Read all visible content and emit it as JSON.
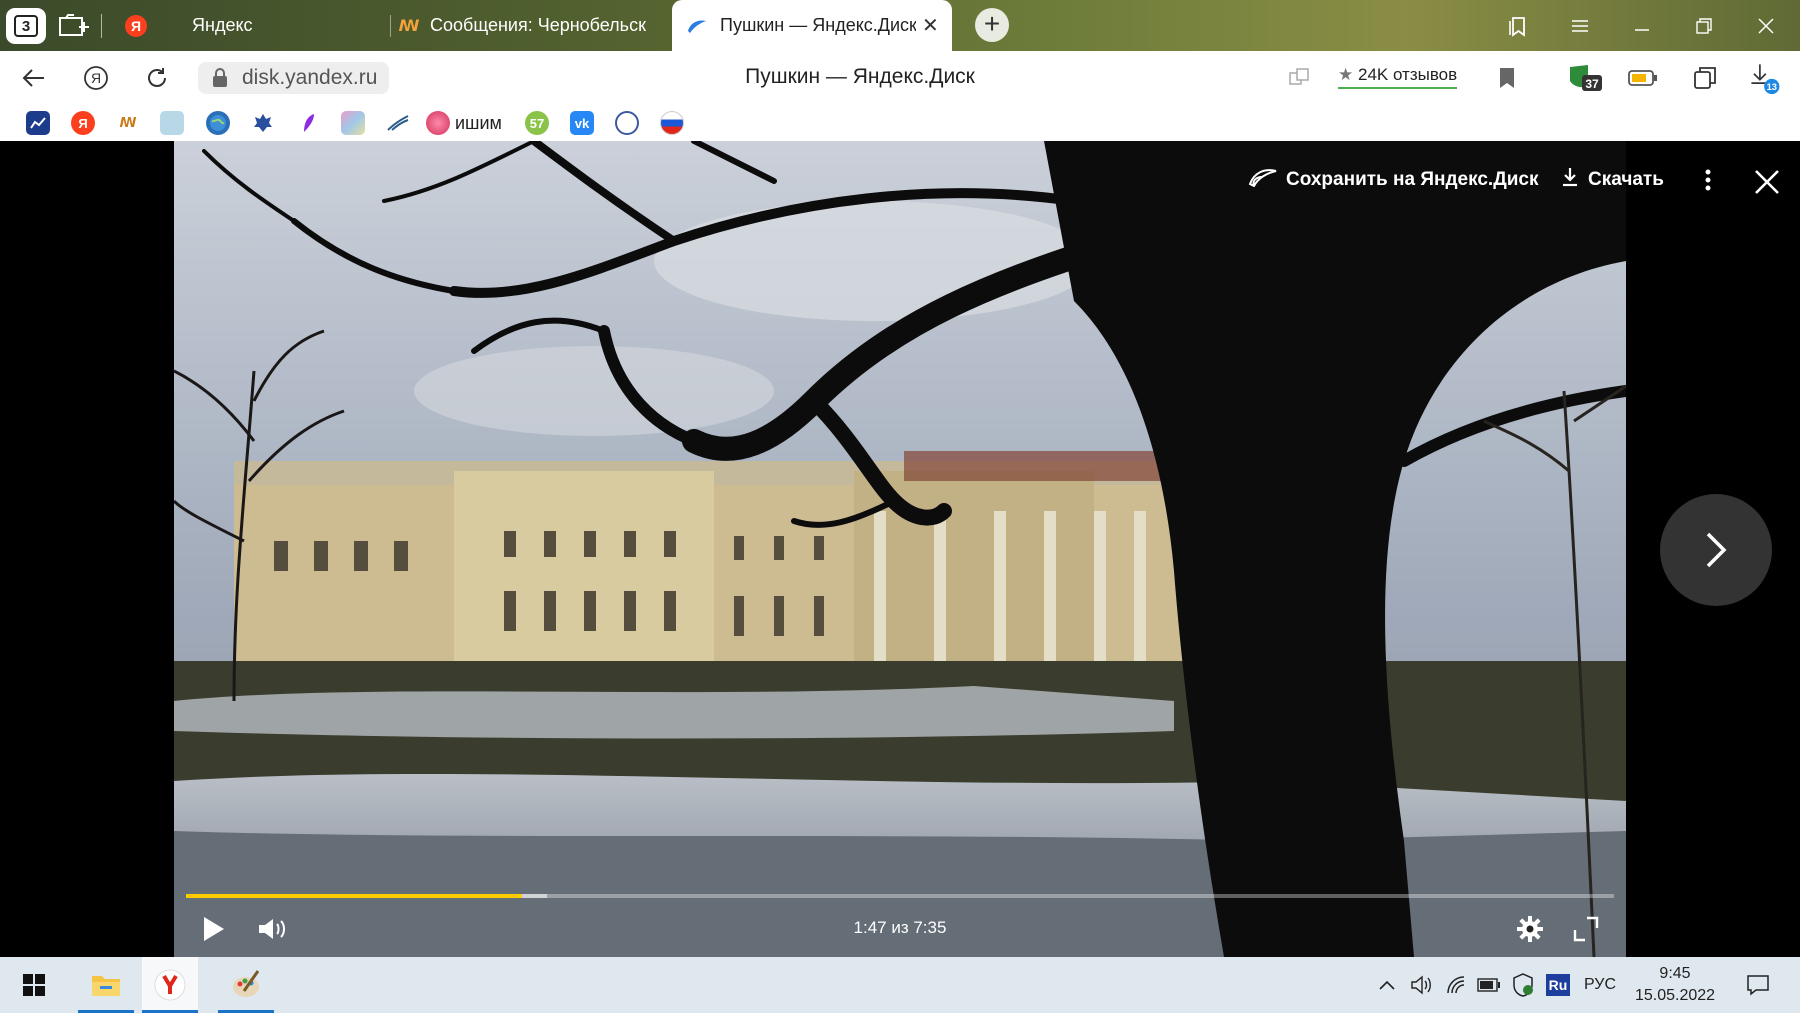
{
  "browser": {
    "tab_count": "3",
    "tabs": [
      {
        "label": "Яндекс",
        "icon": "yandex-icon",
        "active": false
      },
      {
        "label": "Сообщения: Чернобельск",
        "icon": "forum-icon",
        "active": false
      },
      {
        "label": "Пушкин — Яндекс.Диск",
        "icon": "yandex-disk-icon",
        "active": true
      }
    ],
    "url": "disk.yandex.ru",
    "page_title": "Пушкин — Яндекс.Диск",
    "reviews": "24K отзывов",
    "extension_badge": "37",
    "downloads_badge": "13"
  },
  "bookmarks": {
    "text_item": "ишим"
  },
  "viewer": {
    "save_label": "Сохранить на Яндекс.Диск",
    "download_label": "Скачать",
    "time": "1:47 из 7:35",
    "progress_fraction": 0.235,
    "buffered_fraction": 0.253
  },
  "taskbar": {
    "language": "РУС",
    "ime": "Ru",
    "time": "9:45",
    "date": "15.05.2022"
  },
  "colors": {
    "accent_progress": "#ffcc00",
    "yandex_red": "#fc3f1d"
  }
}
